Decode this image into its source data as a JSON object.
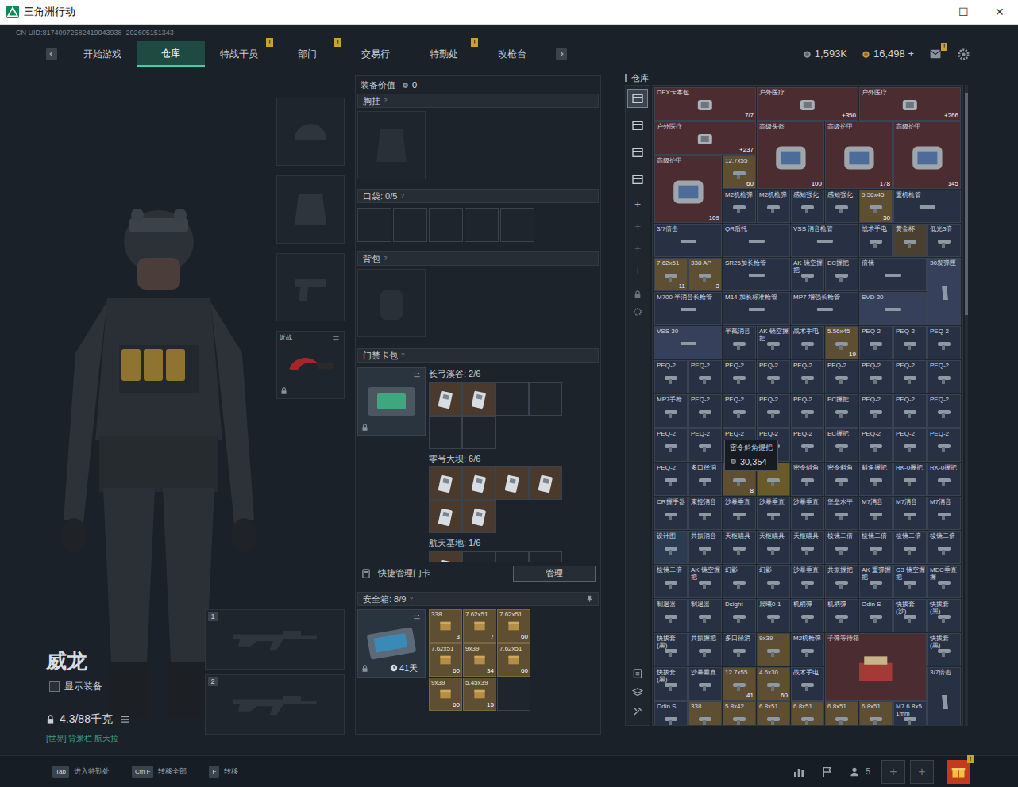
{
  "window": {
    "title": "三角洲行动",
    "controls": [
      "—",
      "☐",
      "✕"
    ]
  },
  "uid": "CN UID:81740972582419043938_202605151343",
  "nav": {
    "tabs": [
      {
        "label": "开始游戏",
        "selected": false
      },
      {
        "label": "仓库",
        "selected": true
      },
      {
        "label": "特战干员",
        "selected": false,
        "badge": "!"
      },
      {
        "label": "部门",
        "selected": false,
        "badge": "!"
      },
      {
        "label": "交易行",
        "selected": false
      },
      {
        "label": "特勤处",
        "selected": false,
        "badge": "!"
      },
      {
        "label": "改枪台",
        "selected": false
      }
    ],
    "currency": [
      "1,593K",
      "16,498 +"
    ],
    "mail_badge": "!"
  },
  "character": {
    "name": "威龙",
    "show_equipment": {
      "label": "显示装备",
      "checked": false
    },
    "weight": "4.3/88千克",
    "status": "[世界] 背景栏 航天拉"
  },
  "slots": {
    "melee": "近战",
    "weapons": [
      "1",
      "2"
    ]
  },
  "loadout": {
    "value_label": "装备价值",
    "value": "0",
    "help": "?",
    "chest": "胸挂",
    "pocket": "口袋: 0/5",
    "backpack": "背包",
    "keycard": "门禁卡包",
    "maps": [
      {
        "name": "长弓溪谷: 2/6",
        "cards": [
          {
            "filled": true
          },
          {
            "filled": true
          },
          {
            "filled": false
          },
          {
            "filled": false
          },
          {
            "filled": false
          },
          {
            "filled": false
          }
        ]
      },
      {
        "name": "零号大坝: 6/6",
        "cards": [
          {
            "filled": true
          },
          {
            "filled": true
          },
          {
            "filled": true
          },
          {
            "filled": true
          },
          {
            "filled": true
          },
          {
            "filled": true
          }
        ]
      },
      {
        "name": "航天基地: 1/6",
        "cards": [
          {
            "filled": true
          },
          {
            "filled": false
          },
          {
            "filled": false
          },
          {
            "filled": false
          }
        ]
      }
    ],
    "quick_manage": "快捷管理门卡",
    "manage_button": "管理",
    "safe": {
      "title": "安全箱: 8/9",
      "timer": "41天",
      "items": [
        {
          "name": "338",
          "count": "3"
        },
        {
          "name": "7.62x51",
          "count": "7"
        },
        {
          "name": "7.62x51",
          "count": "60"
        },
        {
          "name": "7.62x51",
          "count": "60"
        },
        {
          "name": "9x39",
          "count": "34"
        },
        {
          "name": "7.62x51",
          "count": "60"
        },
        {
          "name": "9x39",
          "count": "60"
        },
        {
          "name": "5.45x39",
          "count": "15"
        }
      ]
    }
  },
  "warehouse": {
    "title": "仓库",
    "side_tabs": [
      {
        "selected": true
      },
      {
        "selected": false
      },
      {
        "selected": false
      },
      {
        "selected": false
      }
    ],
    "side_actions": [
      "+",
      "+",
      "+",
      "+"
    ],
    "items": [
      {
        "name": "OEX卡本包",
        "kind": "longer",
        "color": "#4b2d31",
        "count": "7/7"
      },
      {
        "name": "户外医疗",
        "kind": "longer",
        "color": "#4b2d31",
        "count": "+350"
      },
      {
        "name": "户外医疗",
        "kind": "longer",
        "color": "#4b2d31",
        "count": "+266"
      },
      {
        "name": "户外医疗",
        "kind": "longer",
        "color": "#4b2d31",
        "count": "+237"
      },
      {
        "name": "高级头盔",
        "kind": "box",
        "color": "#4b2d31",
        "count": "100"
      },
      {
        "name": "高级护甲",
        "kind": "box",
        "color": "#4b2d31",
        "count": "178"
      },
      {
        "name": "高级护甲",
        "kind": "box",
        "color": "#4b2d31",
        "count": "145"
      },
      {
        "name": "高级护甲",
        "kind": "box",
        "color": "#4b2d31",
        "count": "109"
      },
      {
        "name": "12.7x55",
        "kind": "cell",
        "color": "#5e4e32",
        "count": "60"
      },
      {
        "name": "M2机枪弹",
        "kind": "cell",
        "color": "#283044"
      },
      {
        "name": "M2机枪弹",
        "kind": "cell",
        "color": "#283044"
      },
      {
        "name": "感知强化",
        "kind": "cell",
        "color": "#283044"
      },
      {
        "name": "感知强化",
        "kind": "cell",
        "color": "#283044"
      },
      {
        "name": "5.56x45",
        "kind": "cell",
        "color": "#5e4e32",
        "count": "30"
      },
      {
        "name": "重机枪管",
        "kind": "long",
        "color": "#283044"
      },
      {
        "name": "3/7倍击",
        "kind": "long",
        "color": "#283044"
      },
      {
        "name": "QR后托",
        "kind": "long",
        "color": "#283044"
      },
      {
        "name": "VSS 消音枪管",
        "kind": "long",
        "color": "#283044"
      },
      {
        "name": "战术手电",
        "kind": "cell",
        "color": "#283044"
      },
      {
        "name": "黄金杯",
        "kind": "cell",
        "color": "#4a4030"
      },
      {
        "name": "低光3倍",
        "kind": "cell",
        "color": "#283044"
      },
      {
        "name": "7.62x51",
        "kind": "cell",
        "color": "#5e4e32",
        "count": "11"
      },
      {
        "name": "338 AP",
        "kind": "cell",
        "color": "#5e4e32",
        "count": "3"
      },
      {
        "name": "SR25加长枪管",
        "kind": "long",
        "color": "#283044"
      },
      {
        "name": "AK 镜空握把",
        "kind": "cell",
        "color": "#283044"
      },
      {
        "name": "EC握把",
        "kind": "cell",
        "color": "#283044"
      },
      {
        "name": "倍镜",
        "kind": "long",
        "color": "#283044"
      },
      {
        "name": "30发弹匣",
        "kind": "tall",
        "color": "#36405a"
      },
      {
        "name": "M700 半消音长枪管",
        "kind": "long",
        "color": "#283044"
      },
      {
        "name": "M14 加长标准枪管",
        "kind": "long",
        "color": "#283044"
      },
      {
        "name": "MP7 增强长枪管",
        "kind": "long",
        "color": "#283044"
      },
      {
        "name": "SVD 20",
        "kind": "long",
        "color": "#36405a"
      },
      {
        "name": "VSS 30",
        "kind": "long",
        "color": "#36405a"
      },
      {
        "name": "半截消音",
        "kind": "cell",
        "color": "#283044"
      },
      {
        "name": "AK 镜空握把",
        "kind": "cell",
        "color": "#283044"
      },
      {
        "name": "战术手电",
        "kind": "cell",
        "color": "#283044"
      },
      {
        "name": "5.56x45",
        "kind": "cell",
        "color": "#5e4e32",
        "count": "19"
      },
      {
        "name": "PEQ-2",
        "kind": "cell",
        "color": "#283044"
      },
      {
        "name": "PEQ-2",
        "kind": "cell",
        "color": "#283044"
      },
      {
        "name": "PEQ-2",
        "kind": "cell",
        "color": "#283044"
      },
      {
        "name": "PEQ-2",
        "kind": "cell",
        "color": "#283044"
      },
      {
        "name": "PEQ-2",
        "kind": "cell",
        "color": "#283044"
      },
      {
        "name": "PEQ-2",
        "kind": "cell",
        "color": "#283044"
      },
      {
        "name": "PEQ-2",
        "kind": "cell",
        "color": "#283044"
      },
      {
        "name": "PEQ-2",
        "kind": "cell",
        "color": "#283044"
      },
      {
        "name": "PEQ-2",
        "kind": "cell",
        "color": "#283044"
      },
      {
        "name": "PEQ-2",
        "kind": "cell",
        "color": "#283044"
      },
      {
        "name": "PEQ-2",
        "kind": "cell",
        "color": "#283044"
      },
      {
        "name": "PEQ-2",
        "kind": "cell",
        "color": "#283044"
      },
      {
        "name": "MP7手枪",
        "kind": "cell",
        "color": "#283044"
      },
      {
        "name": "PEQ-2",
        "kind": "cell",
        "color": "#283044"
      },
      {
        "name": "PEQ-2",
        "kind": "cell",
        "color": "#283044"
      },
      {
        "name": "PEQ-2",
        "kind": "cell",
        "color": "#283044"
      },
      {
        "name": "PEQ-2",
        "kind": "cell",
        "color": "#283044"
      },
      {
        "name": "EC握把",
        "kind": "cell",
        "color": "#283044"
      },
      {
        "name": "PEQ-2",
        "kind": "cell",
        "color": "#283044"
      },
      {
        "name": "PEQ-2",
        "kind": "cell",
        "color": "#283044"
      },
      {
        "name": "PEQ-2",
        "kind": "cell",
        "color": "#283044"
      },
      {
        "name": "PEQ-2",
        "kind": "cell",
        "color": "#283044"
      },
      {
        "name": "PEQ-2",
        "kind": "cell",
        "color": "#283044"
      },
      {
        "name": "PEQ-2",
        "kind": "cell",
        "color": "#283044"
      },
      {
        "name": "PEQ-2",
        "kind": "cell",
        "color": "#283044"
      },
      {
        "name": "PEQ-2",
        "kind": "cell",
        "color": "#283044"
      },
      {
        "name": "EC握把",
        "kind": "cell",
        "color": "#283044"
      },
      {
        "name": "PEQ-2",
        "kind": "cell",
        "color": "#283044"
      },
      {
        "name": "PEQ-2",
        "kind": "cell",
        "color": "#283044"
      },
      {
        "name": "PEQ-2",
        "kind": "cell",
        "color": "#283044"
      },
      {
        "name": "PEQ-2",
        "kind": "cell",
        "color": "#283044"
      },
      {
        "name": "多口径消",
        "kind": "cell",
        "color": "#283044"
      },
      {
        "name": "33",
        "kind": "cell",
        "color": "#5e4e32",
        "count": "8"
      },
      {
        "kind": "cell",
        "color": "#6a5a2a"
      },
      {
        "name": "密令斜角",
        "kind": "cell",
        "color": "#283044"
      },
      {
        "name": "密令斜角",
        "kind": "cell",
        "color": "#283044"
      },
      {
        "name": "斜角握把",
        "kind": "cell",
        "color": "#283044"
      },
      {
        "name": "RK-0握把",
        "kind": "cell",
        "color": "#283044"
      },
      {
        "name": "RK-0握把",
        "kind": "cell",
        "color": "#283044"
      },
      {
        "name": "CR握手器",
        "kind": "cell",
        "color": "#283044"
      },
      {
        "name": "束控消音",
        "kind": "cell",
        "color": "#283044"
      },
      {
        "name": "沙暴垂直",
        "kind": "cell",
        "color": "#283044"
      },
      {
        "name": "沙暴垂直",
        "kind": "cell",
        "color": "#283044"
      },
      {
        "name": "沙暴垂直",
        "kind": "cell",
        "color": "#283044"
      },
      {
        "name": "堡垒水平",
        "kind": "cell",
        "color": "#283044"
      },
      {
        "name": "M7消音",
        "kind": "cell",
        "color": "#283044"
      },
      {
        "name": "M7消音",
        "kind": "cell",
        "color": "#283044"
      },
      {
        "name": "M7消音",
        "kind": "cell",
        "color": "#283044"
      },
      {
        "name": "设计图",
        "kind": "cell",
        "color": "#2c3a52"
      },
      {
        "name": "共振消音",
        "kind": "cell",
        "color": "#283044"
      },
      {
        "name": "天枢瞄具",
        "kind": "cell",
        "color": "#283044"
      },
      {
        "name": "天枢瞄具",
        "kind": "cell",
        "color": "#283044"
      },
      {
        "name": "天枢瞄具",
        "kind": "cell",
        "color": "#283044"
      },
      {
        "name": "棱镜二倍",
        "kind": "cell",
        "color": "#283044"
      },
      {
        "name": "棱镜二倍",
        "kind": "cell",
        "color": "#283044"
      },
      {
        "name": "棱镜二倍",
        "kind": "cell",
        "color": "#283044"
      },
      {
        "name": "棱镜二倍",
        "kind": "cell",
        "color": "#283044"
      },
      {
        "name": "棱镜二倍",
        "kind": "cell",
        "color": "#283044"
      },
      {
        "name": "AK 镜空握把",
        "kind": "cell",
        "color": "#283044"
      },
      {
        "name": "幻影",
        "kind": "cell",
        "color": "#283044"
      },
      {
        "name": "幻影",
        "kind": "cell",
        "color": "#283044"
      },
      {
        "name": "沙暴垂直",
        "kind": "cell",
        "color": "#283044"
      },
      {
        "name": "共振握把",
        "kind": "cell",
        "color": "#283044"
      },
      {
        "name": "AK 重弹握把",
        "kind": "cell",
        "color": "#283044"
      },
      {
        "name": "G3 镜空握把",
        "kind": "cell",
        "color": "#283044"
      },
      {
        "name": "MEC垂直握",
        "kind": "cell",
        "color": "#283044"
      },
      {
        "name": "制退器",
        "kind": "cell",
        "color": "#283044"
      },
      {
        "name": "制退器",
        "kind": "cell",
        "color": "#283044"
      },
      {
        "name": "Dsight",
        "kind": "cell",
        "color": "#283044"
      },
      {
        "name": "晨曦0-1",
        "kind": "cell",
        "color": "#283044"
      },
      {
        "name": "机柄弹",
        "kind": "cell",
        "color": "#283044"
      },
      {
        "name": "机柄弹",
        "kind": "cell",
        "color": "#283044"
      },
      {
        "name": "Odin S",
        "kind": "cell",
        "color": "#283044"
      },
      {
        "name": "快拔套(沙)",
        "kind": "cell",
        "color": "#283044"
      },
      {
        "name": "快拔套(黑)",
        "kind": "cell",
        "color": "#283044"
      },
      {
        "name": "快拔套(黑)",
        "kind": "cell",
        "color": "#283044"
      },
      {
        "name": "共振握把",
        "kind": "cell",
        "color": "#283044"
      },
      {
        "name": "多口径消",
        "kind": "cell",
        "color": "#283044"
      },
      {
        "name": "9x39",
        "kind": "cell",
        "color": "#5e4e32"
      },
      {
        "name": "M2机枪弹",
        "kind": "cell",
        "color": "#283044"
      },
      {
        "name": "子弹等待箱",
        "kind": "crate",
        "color": "#4b2d31"
      },
      {
        "name": "快拔套(黑)",
        "kind": "cell",
        "color": "#283044"
      },
      {
        "name": "快拔套(黑)",
        "kind": "cell",
        "color": "#283044"
      },
      {
        "name": "沙暴垂直",
        "kind": "cell",
        "color": "#283044"
      },
      {
        "name": "12.7x55",
        "kind": "cell",
        "color": "#5e4e32",
        "count": "41"
      },
      {
        "name": "4.6x30",
        "kind": "cell",
        "color": "#5e4e32",
        "count": "60"
      },
      {
        "name": "战术手电",
        "kind": "cell",
        "color": "#283044"
      },
      {
        "name": "3/7倍击",
        "kind": "tall",
        "color": "#283044"
      },
      {
        "name": "Odin S",
        "kind": "cell",
        "color": "#283044"
      },
      {
        "name": "338",
        "kind": "cell",
        "color": "#5e4e32"
      },
      {
        "name": "5.8x42",
        "kind": "cell",
        "color": "#5e4e32"
      },
      {
        "name": "6.8x51",
        "kind": "cell",
        "color": "#5e4e32"
      },
      {
        "name": "6.8x51",
        "kind": "cell",
        "color": "#5e4e32"
      },
      {
        "name": "6.8x51",
        "kind": "cell",
        "color": "#5e4e32"
      },
      {
        "name": "6.8x51",
        "kind": "cell",
        "color": "#5e4e32"
      },
      {
        "name": "M7 6.8x51mm",
        "kind": "cell",
        "color": "#283044"
      }
    ],
    "tooltip": {
      "title": "密令斜角握把",
      "value": "30,354"
    }
  },
  "bottom_bar": {
    "hints": [
      {
        "key": "Tab",
        "label": "进入特勤处"
      },
      {
        "key": "Ctrl F",
        "label": "转移全部"
      },
      {
        "key": "F",
        "label": "转移"
      }
    ],
    "friends": "5",
    "add_buttons": [
      "+",
      "+"
    ],
    "gift_badge": "!"
  }
}
